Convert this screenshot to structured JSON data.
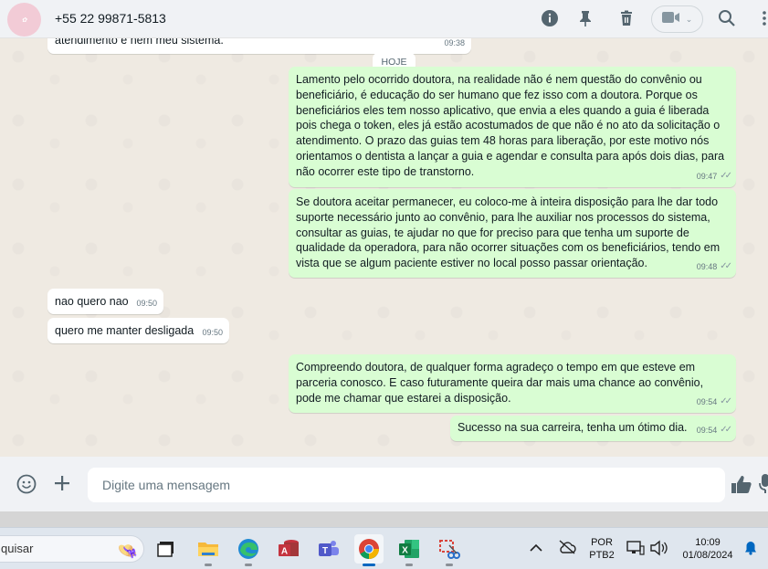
{
  "header": {
    "contact": "+55 22 99871-5813",
    "icons": [
      "info-icon",
      "pin-icon",
      "delete-icon",
      "video-icon",
      "search-icon",
      "menu-icon"
    ]
  },
  "chat": {
    "clipped_message": {
      "text": "atendimento e nem meu sistema.",
      "time": "09:38"
    },
    "day_label": "HOJE",
    "messages": [
      {
        "dir": "out",
        "time": "09:47",
        "text": "Lamento pelo ocorrido doutora, na realidade não é nem questão do convênio ou beneficiário, é educação do ser humano que fez isso com a doutora. Porque os beneficiários eles tem nosso aplicativo, que envia a eles quando a guia é liberada pois chega o token, eles já estão acostumados de que não é no ato da solicitação o atendimento. O prazo das guias tem 48 horas para liberação, por este motivo nós orientamos o dentista a lançar a guia e agendar e consulta para após dois dias, para não ocorrer este tipo de transtorno."
      },
      {
        "dir": "out",
        "time": "09:48",
        "text": "Se doutora aceitar permanecer, eu coloco-me à inteira disposição para lhe dar todo suporte necessário junto ao convênio, para lhe auxiliar nos processos do sistema, consultar as guias, te ajudar no que for preciso para que tenha um suporte de qualidade da operadora, para não ocorrer situações com os beneficiários, tendo em vista que se algum paciente estiver no local posso passar orientação."
      },
      {
        "dir": "in",
        "time": "09:50",
        "text": "nao quero nao"
      },
      {
        "dir": "in",
        "time": "09:50",
        "text": "quero me manter desligada"
      },
      {
        "dir": "out",
        "time": "09:54",
        "text": "Compreendo doutora, de qualquer forma agradeço o tempo em que esteve em parceria conosco. E caso futuramente queira dar mais uma chance ao convênio, pode me chamar que estarei a disposição."
      },
      {
        "dir": "out",
        "time": "09:54",
        "text": "Sucesso na sua carreira, tenha um ótimo dia."
      }
    ]
  },
  "composer": {
    "placeholder": "Digite uma mensagem",
    "icons": [
      "emoji-icon",
      "attach-plus-icon",
      "thumbs-up-icon",
      "microphone-icon"
    ]
  },
  "taskbar": {
    "search_text": "quisar",
    "apps": [
      "task-view-icon",
      "file-explorer-icon",
      "edge-icon",
      "access-icon",
      "teams-icon",
      "chrome-icon",
      "excel-icon",
      "snipping-tool-icon"
    ],
    "active_app": "chrome-icon",
    "language": "POR",
    "keyboard": "PTB2",
    "time": "10:09",
    "date": "01/08/2024"
  },
  "colors": {
    "outgoing_bubble": "#d9fdd3",
    "incoming_bubble": "#ffffff",
    "chat_bg": "#efeae2",
    "header_bg": "#f0f2f5"
  }
}
